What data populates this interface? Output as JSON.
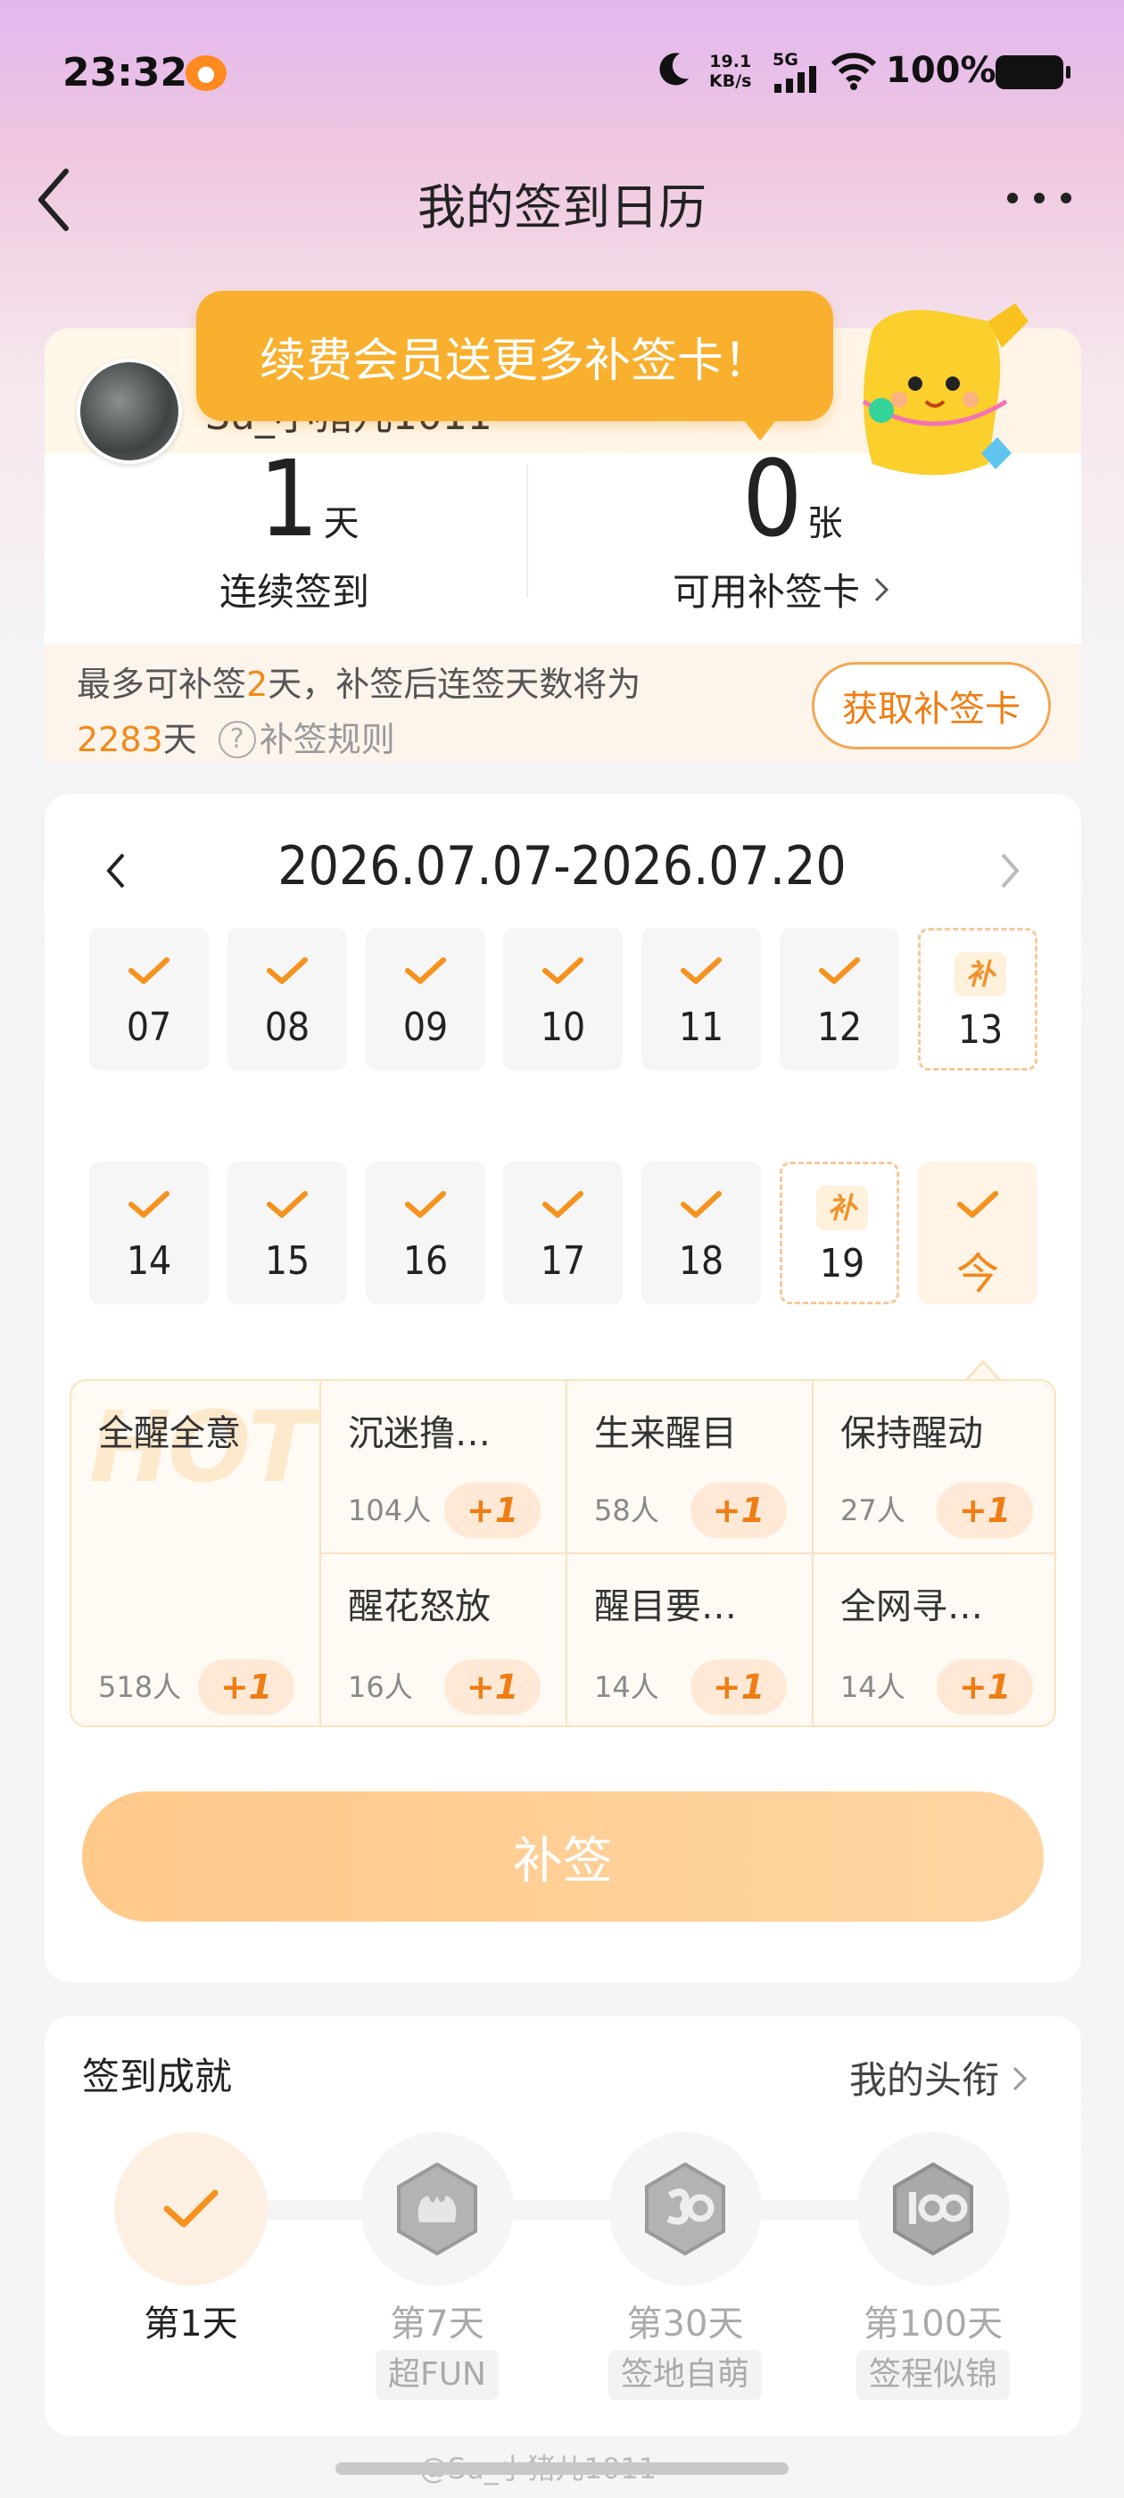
{
  "status_bar": {
    "time": "23:32",
    "speed": "19.1",
    "speed_unit": "KB/s",
    "network": "5G",
    "battery": "100%"
  },
  "header": {
    "title": "我的签到日历"
  },
  "profile": {
    "username": "Su_小猪儿1011",
    "tooltip": "续费会员送更多补签卡！",
    "streak_days": "1",
    "streak_unit": "天",
    "streak_label": "连续签到",
    "cards_count": "0",
    "cards_unit": "张",
    "cards_label": "可用补签卡",
    "makeup_prefix": "最多可补签",
    "makeup_days": "2",
    "makeup_mid": "天，补签后连签天数将为",
    "makeup_result": "2283",
    "makeup_result_unit": "天",
    "rules_label": "补签规则",
    "get_card_button": "获取补签卡"
  },
  "calendar": {
    "range": "2026.07.07-2026.07.20",
    "days": [
      {
        "num": "07",
        "state": "checked"
      },
      {
        "num": "08",
        "state": "checked"
      },
      {
        "num": "09",
        "state": "checked"
      },
      {
        "num": "10",
        "state": "checked"
      },
      {
        "num": "11",
        "state": "checked"
      },
      {
        "num": "12",
        "state": "checked"
      },
      {
        "num": "13",
        "state": "makeup"
      },
      {
        "num": "14",
        "state": "checked"
      },
      {
        "num": "15",
        "state": "checked"
      },
      {
        "num": "16",
        "state": "checked"
      },
      {
        "num": "17",
        "state": "checked"
      },
      {
        "num": "18",
        "state": "checked"
      },
      {
        "num": "19",
        "state": "makeup"
      },
      {
        "num": "今",
        "state": "today"
      }
    ],
    "makeup_mark": "补"
  },
  "badges": {
    "featured": {
      "name": "全醒全意",
      "count": "518人",
      "hot_text": "HOT"
    },
    "items": [
      {
        "name": "沉迷撸…",
        "count": "104人"
      },
      {
        "name": "生来醒目",
        "count": "58人"
      },
      {
        "name": "保持醒动",
        "count": "27人"
      },
      {
        "name": "醒花怒放",
        "count": "16人"
      },
      {
        "name": "醒目要…",
        "count": "14人"
      },
      {
        "name": "全网寻…",
        "count": "14人"
      }
    ],
    "plus_label": "+1"
  },
  "makeup_button": "补签",
  "achievements": {
    "title": "签到成就",
    "link": "我的头衔",
    "items": [
      {
        "day": "第1天",
        "tag": "",
        "done": true
      },
      {
        "day": "第7天",
        "tag": "超FUN",
        "done": false
      },
      {
        "day": "第30天",
        "tag": "签地自萌",
        "done": false
      },
      {
        "day": "第100天",
        "tag": "签程似锦",
        "done": false
      }
    ]
  },
  "watermark": "@Su_小猪儿1011",
  "colors": {
    "accent": "#f08a1a",
    "tooltip": "#f9b02e",
    "check": "#f5921e"
  }
}
